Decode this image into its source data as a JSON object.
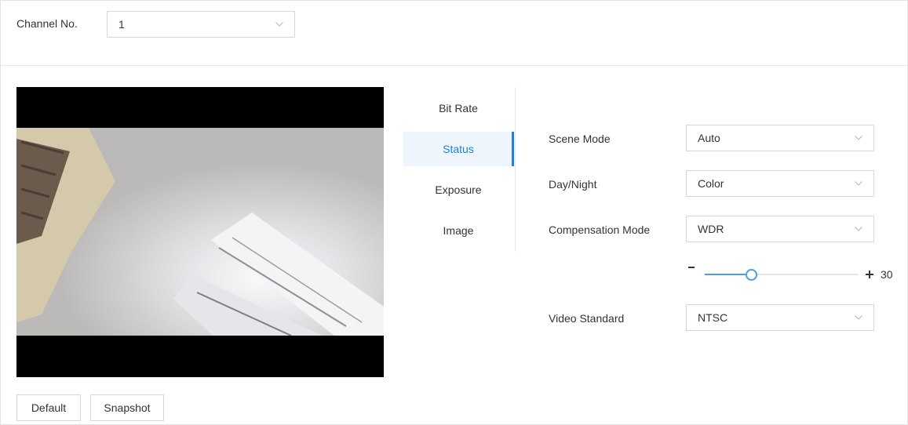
{
  "channel": {
    "label": "Channel No.",
    "value": "1"
  },
  "tabs": [
    {
      "label": "Bit Rate",
      "active": false
    },
    {
      "label": "Status",
      "active": true
    },
    {
      "label": "Exposure",
      "active": false
    },
    {
      "label": "Image",
      "active": false
    }
  ],
  "settings": {
    "scene_mode": {
      "label": "Scene Mode",
      "value": "Auto"
    },
    "day_night": {
      "label": "Day/Night",
      "value": "Color"
    },
    "compensation_mode": {
      "label": "Compensation Mode",
      "value": "WDR"
    },
    "wdr_level": {
      "value": 30,
      "display": "30",
      "min": 0,
      "max": 100
    },
    "video_standard": {
      "label": "Video Standard",
      "value": "NTSC"
    }
  },
  "buttons": {
    "default": "Default",
    "snapshot": "Snapshot"
  },
  "colors": {
    "accent": "#1a85d6",
    "active_tab_bg": "#eef5fc",
    "border": "#d6d6d6"
  },
  "icons": {
    "dropdown": "chevron-down-icon",
    "minus": "minus-icon",
    "plus": "plus-icon"
  }
}
